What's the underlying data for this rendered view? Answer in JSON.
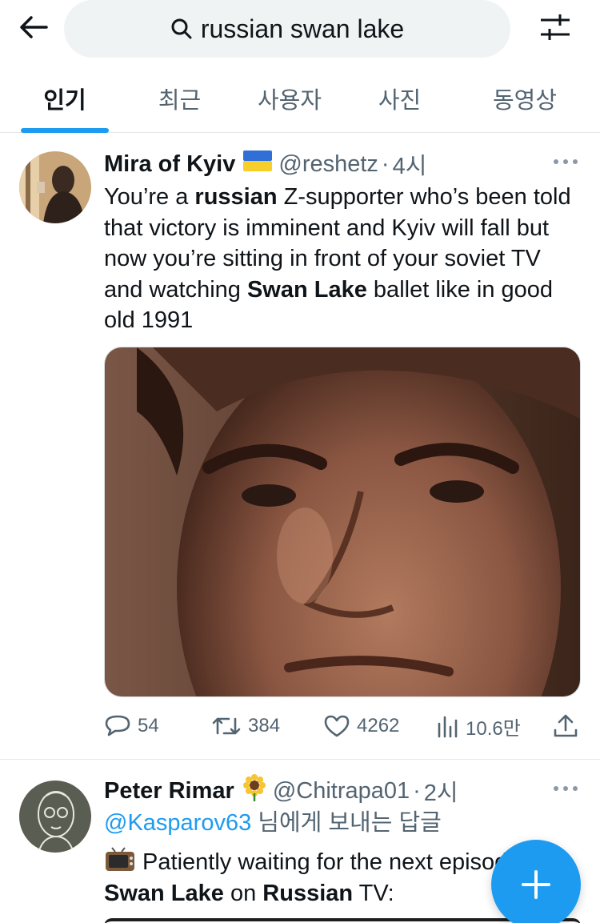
{
  "search": {
    "query": "russian swan lake"
  },
  "tabs": [
    {
      "label": "인기",
      "active": true
    },
    {
      "label": "최근"
    },
    {
      "label": "사용자"
    },
    {
      "label": "사진"
    },
    {
      "label": "동영상"
    }
  ],
  "tweets": [
    {
      "name": "Mira of Kyiv",
      "handle": "@reshetz",
      "dot": "·",
      "time": "4시",
      "text": {
        "p1": "You’re a ",
        "b1": "russian",
        "p2": " Z-supporter who’s been told that victory is imminent and Kyiv will fall but now you’re sitting in front of your soviet TV and watching ",
        "b2": "Swan Lake",
        "p3": " ballet like in good old 1991"
      },
      "stats": {
        "replies": "54",
        "retweets": "384",
        "likes": "4262",
        "views": "10.6만"
      }
    },
    {
      "name": "Peter Rimar",
      "handle": "@Chitrapa01",
      "dot": "·",
      "time": "2시",
      "reply_mention": "@Kasparov63",
      "reply_text": " 님에게 보내는 답글",
      "text": {
        "p1": " Patiently waiting for the next episode of",
        "b1": "Swan Lake",
        "p2": " on ",
        "b2": "Russian",
        "p3": " TV:"
      }
    }
  ],
  "colors": {
    "accent": "#1d9bf0",
    "muted": "#536471",
    "text": "#0f1419"
  }
}
